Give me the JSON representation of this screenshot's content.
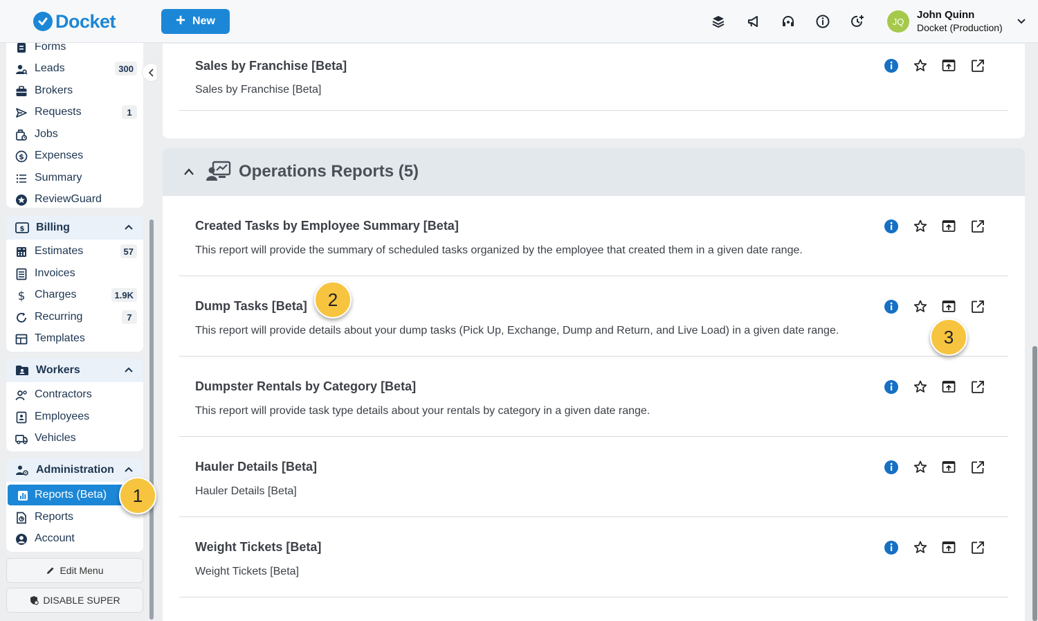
{
  "app": {
    "logo_text": "Docket",
    "brand_color": "#1c87d6"
  },
  "header": {
    "new_label": "New",
    "icons": [
      "layers-icon",
      "megaphone-icon",
      "headset-icon",
      "info-icon",
      "clock-plus-icon"
    ],
    "user": {
      "initials": "JQ",
      "name": "John Quinn",
      "org": "Docket (Production)"
    }
  },
  "sidebar": {
    "top_items": [
      {
        "label": "Forms",
        "icon": "forms-icon"
      },
      {
        "label": "Leads",
        "badge": "300",
        "icon": "leads-icon"
      },
      {
        "label": "Brokers",
        "icon": "briefcase-icon"
      },
      {
        "label": "Requests",
        "badge": "1",
        "icon": "send-icon"
      },
      {
        "label": "Jobs",
        "icon": "jobs-icon"
      },
      {
        "label": "Expenses",
        "icon": "dollar-circle-icon"
      },
      {
        "label": "Summary",
        "icon": "list-icon"
      },
      {
        "label": "ReviewGuard",
        "icon": "star-badge-icon"
      }
    ],
    "billing": {
      "title": "Billing",
      "items": [
        {
          "label": "Estimates",
          "badge": "57"
        },
        {
          "label": "Invoices"
        },
        {
          "label": "Charges",
          "badge": "1.9K"
        },
        {
          "label": "Recurring",
          "badge": "7"
        },
        {
          "label": "Templates"
        }
      ]
    },
    "workers": {
      "title": "Workers",
      "items": [
        {
          "label": "Contractors"
        },
        {
          "label": "Employees"
        },
        {
          "label": "Vehicles"
        }
      ]
    },
    "administration": {
      "title": "Administration",
      "items": [
        {
          "label": "Reports (Beta)",
          "active": true
        },
        {
          "label": "Reports"
        },
        {
          "label": "Account"
        }
      ]
    },
    "edit_menu_label": "Edit Menu",
    "disable_super_label": "DISABLE SUPER"
  },
  "main": {
    "top_report": {
      "title": "Sales by Franchise [Beta]",
      "description": "Sales by Franchise [Beta]"
    },
    "operations": {
      "title": "Operations Reports (5)",
      "reports": [
        {
          "title": "Created Tasks by Employee Summary [Beta]",
          "description": "This report will provide the summary of scheduled tasks organized by the employee that created them in a given date range."
        },
        {
          "title": "Dump Tasks [Beta]",
          "description": "This report will provide details about your dump tasks (Pick Up, Exchange, Dump and Return, and Live Load) in a given date range."
        },
        {
          "title": "Dumpster Rentals by Category [Beta]",
          "description": "This report will provide task type details about your rentals by category in a given date range."
        },
        {
          "title": "Hauler Details [Beta]",
          "description": "Hauler Details [Beta]"
        },
        {
          "title": "Weight Tickets [Beta]",
          "description": "Weight Tickets [Beta]"
        }
      ]
    }
  },
  "markers": [
    "1",
    "2",
    "3"
  ]
}
